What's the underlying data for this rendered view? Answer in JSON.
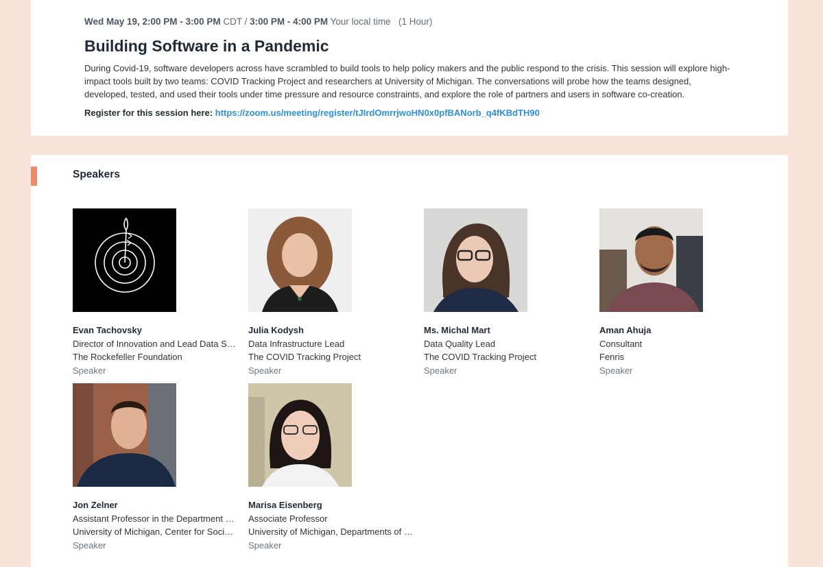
{
  "session": {
    "time_bold_1": "Wed May 19, 2:00 PM - 3:00 PM",
    "tz_1": " CDT / ",
    "time_bold_2": "3:00 PM - 4:00 PM",
    "tz_2": " Your local time",
    "duration": "(1 Hour)",
    "title": "Building Software in a Pandemic",
    "description": "During Covid-19, software developers across have scrambled to build tools to help policy makers and the public respond to the crisis. This session will explore high-impact tools built by two teams: COVID Tracking Project and researchers at University of Michigan. The conversations will probe how the teams designed, developed, tested, and used their tools under time pressure and resource constraints, and explore the role of partners and users in software co-creation.",
    "register_label": "Register for this session here:",
    "register_link": "https://zoom.us/meeting/register/tJIrdOmrrjwoHN0x0pfBANorb_q4fKBdTH90"
  },
  "speakers_heading": "Speakers",
  "speakers": [
    {
      "name": "Evan Tachovsky",
      "title": "Director of Innovation and Lead Data Scie…",
      "org": "The Rockefeller Foundation",
      "role": "Speaker"
    },
    {
      "name": "Julia Kodysh",
      "title": "Data Infrastructure Lead",
      "org": "The COVID Tracking Project",
      "role": "Speaker"
    },
    {
      "name": "Ms. Michal Mart",
      "title": "Data Quality Lead",
      "org": "The COVID Tracking Project",
      "role": "Speaker"
    },
    {
      "name": "Aman Ahuja",
      "title": "Consultant",
      "org": "Fenris",
      "role": "Speaker"
    },
    {
      "name": "Jon Zelner",
      "title": "Assistant Professor in the Department of …",
      "org": "University of Michigan, Center for Social E…",
      "role": "Speaker"
    },
    {
      "name": "Marisa Eisenberg",
      "title": "Associate Professor",
      "org": "University of Michigan, Departments of E…",
      "role": "Speaker"
    }
  ],
  "colors": {
    "page_bg": "#fae3db",
    "accent": "#ee8a67",
    "link": "#2d8fd5"
  }
}
